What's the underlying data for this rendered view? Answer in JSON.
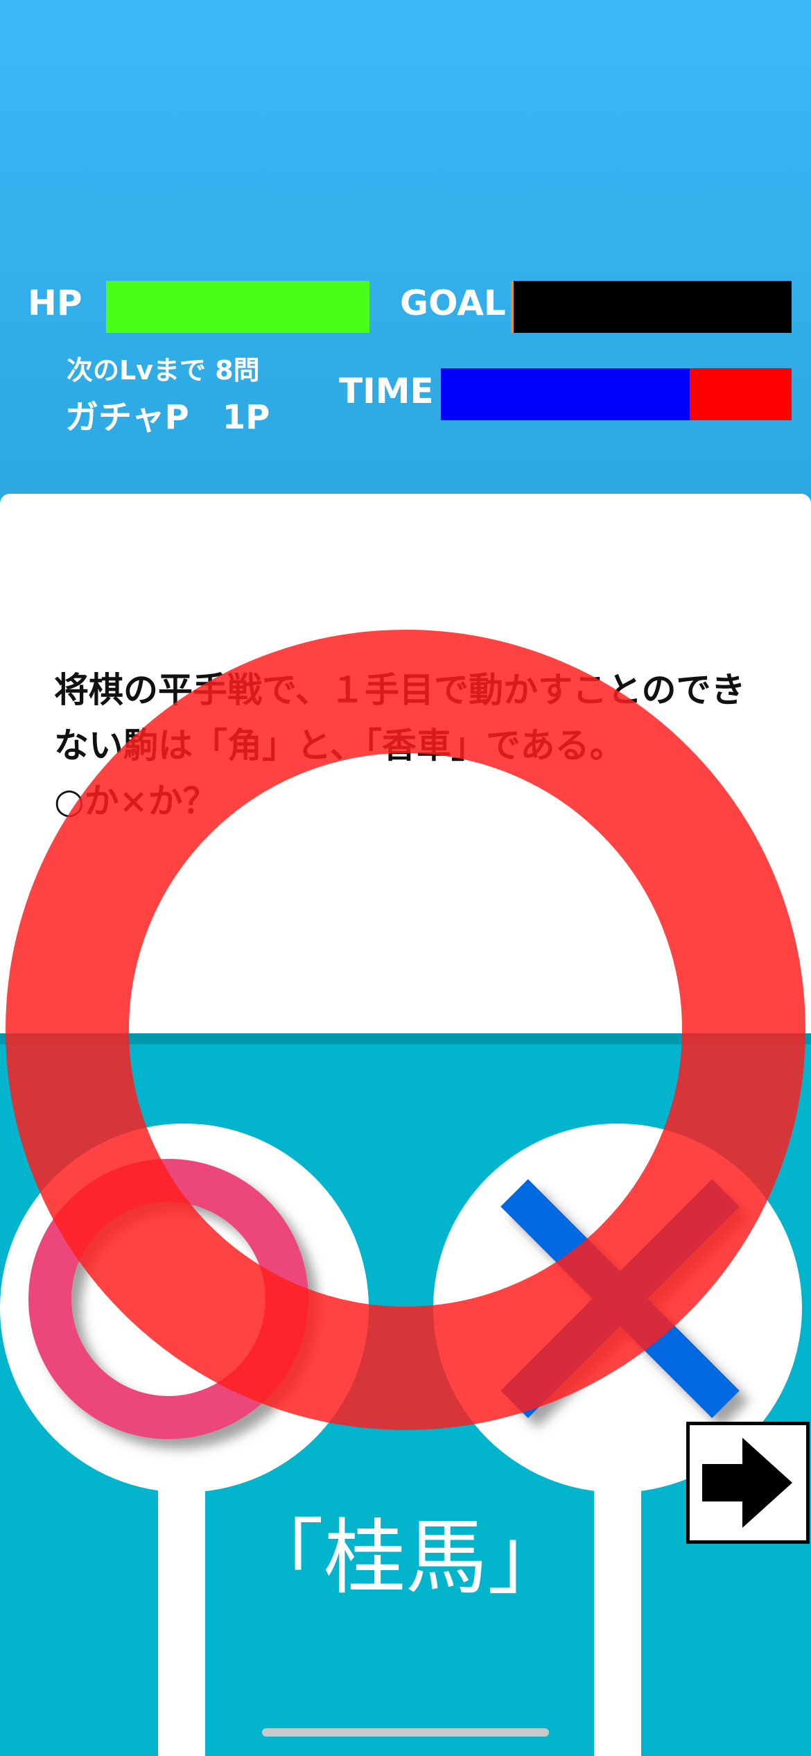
{
  "status": {
    "hp_label": "HP",
    "hp_fraction": 1.0,
    "goal_label": "GOAL",
    "goal_fraction": 0.01,
    "next_level": "次のLvまで 8問",
    "gacha_points": "ガチャP　1P",
    "time_label": "TIME",
    "time_remaining_fraction": 0.71
  },
  "question": {
    "text": "将棋の平手戦で、１手目で動かすことのできない駒は「角」と、「香車」である。\n○か×か？"
  },
  "answer": {
    "revealed_answer": "「桂馬」",
    "result_mark": "correct-circle"
  },
  "colors": {
    "sky": "#3db8f9",
    "hp_bar": "#48ff15",
    "time_remaining": "#0000ff",
    "time_elapsed": "#ff0000",
    "maru_button": "#ec467a",
    "batsu_button": "#0667e0",
    "result_overlay": "#ff1e1e"
  }
}
